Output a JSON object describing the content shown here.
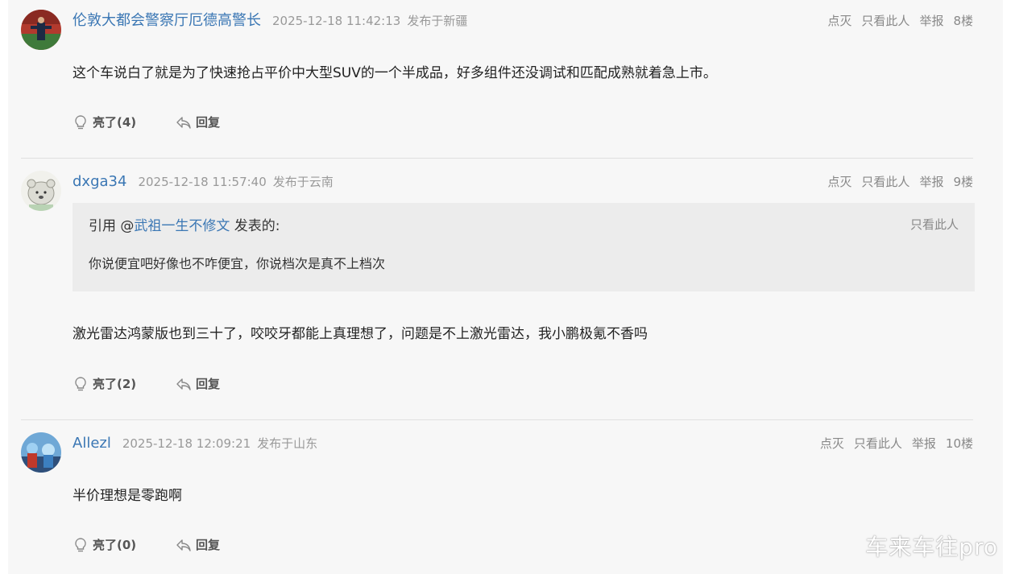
{
  "posts": [
    {
      "username": "伦敦大都会警察厅厄德高警长",
      "time": "2025-12-18 11:42:13",
      "location": "发布于新疆",
      "actions": {
        "dim": "点灭",
        "only": "只看此人",
        "report": "举报",
        "floor": "8楼"
      },
      "content": "这个车说白了就是为了快速抢占平价中大型SUV的一个半成品，好多组件还没调试和匹配成熟就着急上市。",
      "like_label": "亮了(4)",
      "reply_label": "回复"
    },
    {
      "username": "dxga34",
      "time": "2025-12-18 11:57:40",
      "location": "发布于云南",
      "actions": {
        "dim": "点灭",
        "only": "只看此人",
        "report": "举报",
        "floor": "9楼"
      },
      "quote": {
        "prefix": "引用 @",
        "user": "武祖一生不修文",
        "suffix": " 发表的:",
        "only": "只看此人",
        "text": "你说便宜吧好像也不咋便宜，你说档次是真不上档次"
      },
      "content": "激光雷达鸿蒙版也到三十了，咬咬牙都能上真理想了，问题是不上激光雷达，我小鹏极氪不香吗",
      "like_label": "亮了(2)",
      "reply_label": "回复"
    },
    {
      "username": "Allezl",
      "time": "2025-12-18 12:09:21",
      "location": "发布于山东",
      "actions": {
        "dim": "点灭",
        "only": "只看此人",
        "report": "举报",
        "floor": "10楼"
      },
      "content": "半价理想是零跑啊",
      "like_label": "亮了(0)",
      "reply_label": "回复"
    }
  ],
  "watermark": "车来车往pro"
}
